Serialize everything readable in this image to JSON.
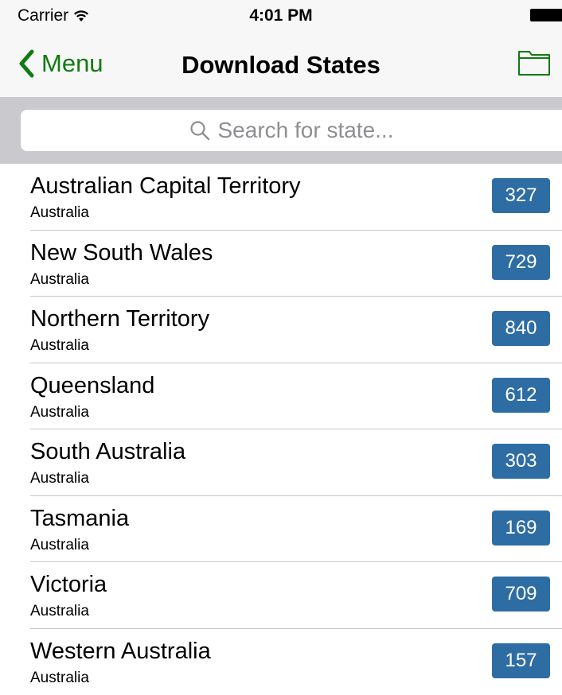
{
  "status_bar": {
    "carrier": "Carrier",
    "time": "4:01 PM"
  },
  "nav": {
    "back_label": "Menu",
    "title": "Download States",
    "accent_color": "#127a12"
  },
  "search": {
    "placeholder": "Search for state..."
  },
  "badge_color": "#2e6da4",
  "states": [
    {
      "name": "Australian Capital Territory",
      "country": "Australia",
      "count": "327"
    },
    {
      "name": "New South Wales",
      "country": "Australia",
      "count": "729"
    },
    {
      "name": "Northern Territory",
      "country": "Australia",
      "count": "840"
    },
    {
      "name": "Queensland",
      "country": "Australia",
      "count": "612"
    },
    {
      "name": "South Australia",
      "country": "Australia",
      "count": "303"
    },
    {
      "name": "Tasmania",
      "country": "Australia",
      "count": "169"
    },
    {
      "name": "Victoria",
      "country": "Australia",
      "count": "709"
    },
    {
      "name": "Western Australia",
      "country": "Australia",
      "count": "157"
    }
  ]
}
